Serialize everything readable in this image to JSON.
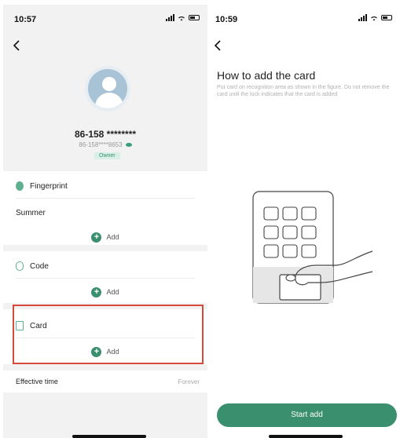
{
  "left": {
    "status_time": "10:57",
    "back_icon": "chevron-left-icon",
    "profile": {
      "phone": "86-158 ********",
      "phone_masked": "86-158****8653",
      "role": "Owner"
    },
    "fingerprint": {
      "label": "Fingerprint",
      "user": "Summer",
      "add_label": "Add"
    },
    "code": {
      "label": "Code",
      "add_label": "Add"
    },
    "card": {
      "label": "Card",
      "add_label": "Add"
    },
    "effective_time": {
      "label": "Effective time",
      "value": "Forever"
    }
  },
  "right": {
    "status_time": "10:59",
    "back_icon": "chevron-left-icon",
    "title": "How to add the card",
    "description": "Put card on recognition area as shown in the figure. Do not remove the card until the lock indicates that the card is added",
    "start_button": "Start add"
  },
  "colors": {
    "accent": "#3a8f6e",
    "highlight_box": "#d74a3a",
    "page_bg": "#f2f2f2"
  }
}
